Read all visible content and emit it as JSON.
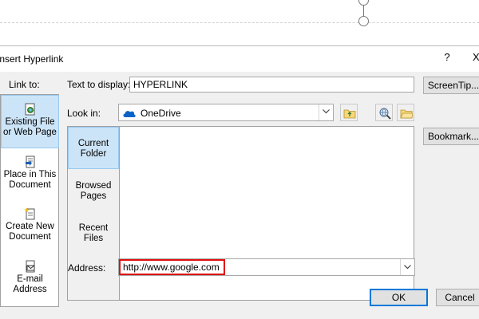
{
  "dialog": {
    "title": "Insert Hyperlink",
    "help_glyph": "?",
    "close_glyph": "X"
  },
  "link_to": {
    "label": "Link to:",
    "items": [
      {
        "label_1": "Existing File",
        "label_2": "or Web Page",
        "icon": "web-page-icon",
        "selected": true
      },
      {
        "label_1": "Place in This",
        "label_2": "Document",
        "icon": "document-place-icon",
        "selected": false
      },
      {
        "label_1": "Create New",
        "label_2": "Document",
        "icon": "new-document-icon",
        "selected": false
      },
      {
        "label_1": "E-mail",
        "label_2": "Address",
        "icon": "email-icon",
        "selected": false
      }
    ]
  },
  "text_to_display": {
    "label": "Text to display:",
    "value": "HYPERLINK"
  },
  "screentip_button": "ScreenTip...",
  "look_in": {
    "label": "Look in:",
    "value": "OneDrive",
    "icon": "onedrive-cloud-icon"
  },
  "tools": {
    "up_folder_icon": "up-folder-icon",
    "browse_web_icon": "browse-web-icon",
    "browse_file_icon": "browse-file-icon"
  },
  "browse_tabs": [
    {
      "label_1": "Current",
      "label_2": "Folder",
      "selected": true
    },
    {
      "label_1": "Browsed",
      "label_2": "Pages",
      "selected": false
    },
    {
      "label_1": "Recent",
      "label_2": "Files",
      "selected": false
    }
  ],
  "bookmark_button": "Bookmark...",
  "address": {
    "label": "Address:",
    "value": "http://www.google.com"
  },
  "ok_button": "OK",
  "cancel_button": "Cancel",
  "colors": {
    "selection": "#cce4f7",
    "highlight_border": "#e01010",
    "default_button_border": "#0078d7",
    "onedrive": "#0a64c8"
  }
}
